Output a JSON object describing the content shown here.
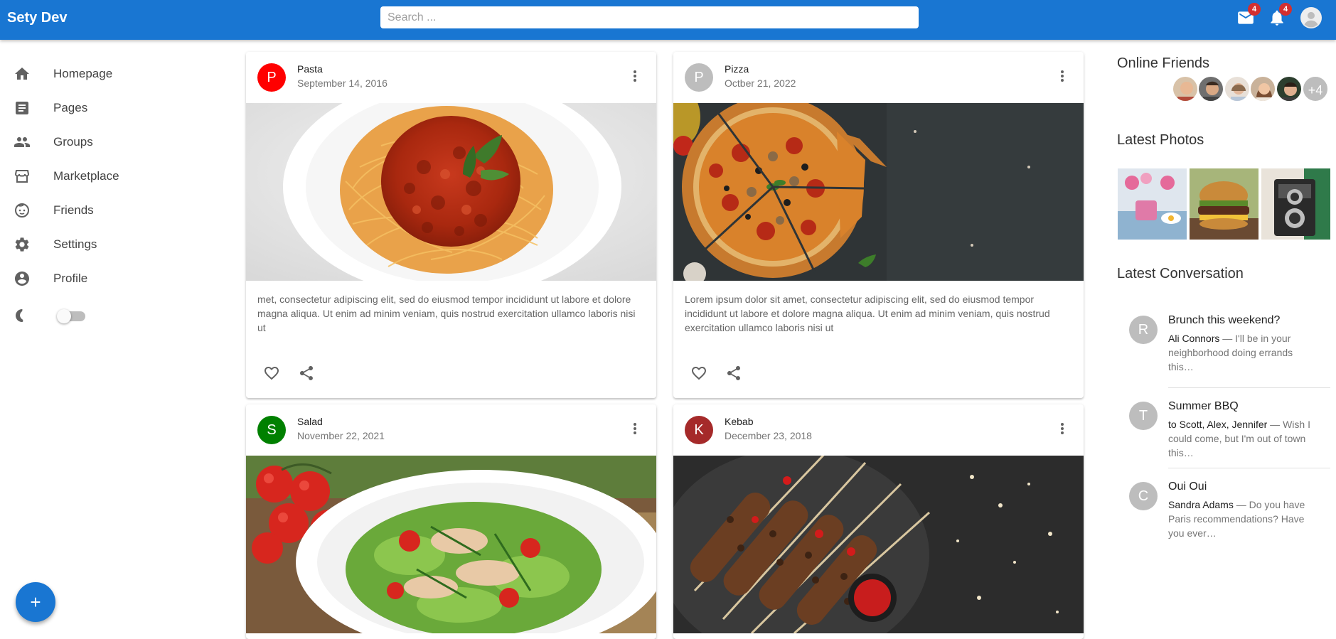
{
  "app": {
    "title": "Sety Dev"
  },
  "search": {
    "placeholder": "Search ..."
  },
  "header_icons": {
    "mail": {
      "icon": "mail-icon",
      "count": "4"
    },
    "notifications": {
      "icon": "bell-icon",
      "count": "4"
    },
    "account": {
      "icon": "account-circle-icon"
    }
  },
  "sidebar": {
    "items": [
      {
        "label": "Homepage",
        "icon": "home-icon"
      },
      {
        "label": "Pages",
        "icon": "article-icon"
      },
      {
        "label": "Groups",
        "icon": "groups-icon"
      },
      {
        "label": "Marketplace",
        "icon": "storefront-icon"
      },
      {
        "label": "Friends",
        "icon": "child-face-icon"
      },
      {
        "label": "Settings",
        "icon": "gear-icon"
      },
      {
        "label": "Profile",
        "icon": "account-circle-icon"
      }
    ],
    "dark_mode": {
      "icon": "moon-icon",
      "checked": false
    },
    "fab": {
      "label": "+"
    }
  },
  "posts": [
    {
      "initial": "P",
      "avatar_color": "#ff0000",
      "title": "Pasta",
      "date": "September 14, 2016",
      "image": "pasta-photo",
      "text": "met, consectetur adipiscing elit, sed do eiusmod tempor incididunt ut labore et dolore magna aliqua. Ut enim ad minim veniam, quis nostrud exercitation ullamco laboris nisi ut"
    },
    {
      "initial": "P",
      "avatar_color": "#bdbdbd",
      "title": "Pizza",
      "date": "Octber 21, 2022",
      "image": "pizza-photo",
      "text": "Lorem ipsum dolor sit amet, consectetur adipiscing elit, sed do eiusmod tempor incididunt ut labore et dolore magna aliqua. Ut enim ad minim veniam, quis nostrud exercitation ullamco laboris nisi ut"
    },
    {
      "initial": "S",
      "avatar_color": "#008000",
      "title": "Salad",
      "date": "November 22, 2021",
      "image": "salad-photo",
      "text": ""
    },
    {
      "initial": "K",
      "avatar_color": "#a52a2a",
      "title": "Kebab",
      "date": "December 23, 2018",
      "image": "kebab-photo",
      "text": ""
    }
  ],
  "right": {
    "online_friends": {
      "heading": "Online Friends",
      "extra_count": "+4"
    },
    "latest_photos": {
      "heading": "Latest Photos"
    },
    "latest_conversation": {
      "heading": "Latest Conversation",
      "items": [
        {
          "initial": "R",
          "title": "Brunch this weekend?",
          "sender": "Ali Connors",
          "preview": " — I'll be in your neighborhood doing errands this…"
        },
        {
          "initial": "T",
          "title": "Summer BBQ",
          "sender": "to Scott, Alex, Jennifer",
          "preview": " — Wish I could come, but I'm out of town this…"
        },
        {
          "initial": "C",
          "title": "Oui Oui",
          "sender": "Sandra Adams",
          "preview": " — Do you have Paris recommendations? Have you ever…"
        }
      ]
    }
  },
  "colors": {
    "primary": "#1976d2",
    "badge": "#d32f2f"
  }
}
